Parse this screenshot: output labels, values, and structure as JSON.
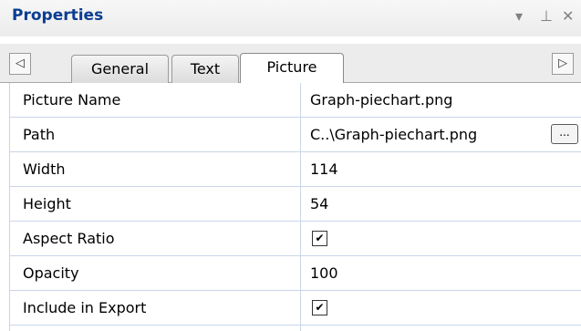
{
  "panel": {
    "title": "Properties",
    "controls": {
      "dropdown_glyph": "▾",
      "pin_glyph": "⊥",
      "close_glyph": "✕"
    }
  },
  "tabs": {
    "scroll_left_glyph": "◁",
    "scroll_right_glyph": "▷",
    "items": [
      {
        "label": "General",
        "active": false
      },
      {
        "label": "Text",
        "active": false
      },
      {
        "label": "Picture",
        "active": true
      }
    ]
  },
  "properties": [
    {
      "name": "Picture Name",
      "value": "Graph-piechart.png",
      "type": "text"
    },
    {
      "name": "Path",
      "value": "C..\\Graph-piechart.png",
      "type": "path",
      "button_label": "..."
    },
    {
      "name": "Width",
      "value": "114",
      "type": "text"
    },
    {
      "name": "Height",
      "value": "54",
      "type": "text"
    },
    {
      "name": "Aspect Ratio",
      "value": "",
      "type": "checkbox",
      "checked": true,
      "check_glyph": "✔"
    },
    {
      "name": "Opacity",
      "value": "100",
      "type": "text"
    },
    {
      "name": "Include in Export",
      "value": "",
      "type": "checkbox",
      "checked": true,
      "check_glyph": "✔"
    }
  ],
  "colors": {
    "title": "#0b3d91",
    "grid_lines": "#c9d6e8"
  }
}
